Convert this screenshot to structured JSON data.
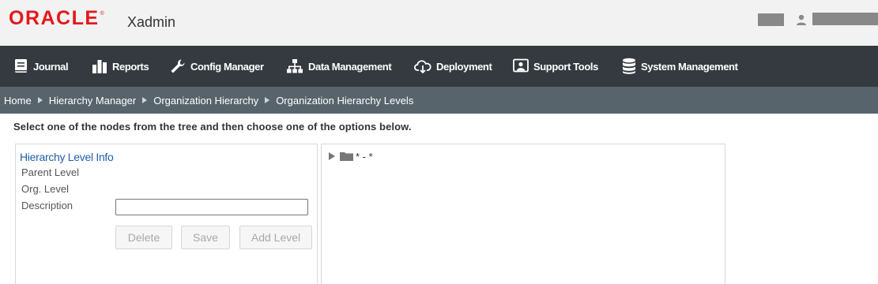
{
  "header": {
    "brand": "ORACLE",
    "app_name": "Xadmin"
  },
  "nav": {
    "items": [
      {
        "label": "Journal",
        "icon": "journal-icon"
      },
      {
        "label": "Reports",
        "icon": "bar-chart-icon"
      },
      {
        "label": "Config Manager",
        "icon": "wrench-icon"
      },
      {
        "label": "Data Management",
        "icon": "hierarchy-icon"
      },
      {
        "label": "Deployment",
        "icon": "cloud-download-icon"
      },
      {
        "label": "Support Tools",
        "icon": "support-icon"
      },
      {
        "label": "System Management",
        "icon": "database-icon"
      }
    ]
  },
  "breadcrumb": [
    "Home",
    "Hierarchy Manager",
    "Organization Hierarchy",
    "Organization Hierarchy Levels"
  ],
  "instruction": "Select one of the nodes from the tree and then choose one of the options below.",
  "info_panel": {
    "title": "Hierarchy Level Info",
    "parent_level_label": "Parent Level",
    "org_level_label": "Org. Level",
    "description_label": "Description",
    "description_value": "",
    "buttons": {
      "delete": "Delete",
      "save": "Save",
      "add_level": "Add Level"
    }
  },
  "tree": {
    "root_label": "* - *",
    "expanded": false
  },
  "colors": {
    "brand_red": "#e4181b",
    "nav_bg": "#353a40",
    "breadcrumb_bg": "#58646c",
    "link_blue": "#1f5fa9"
  }
}
